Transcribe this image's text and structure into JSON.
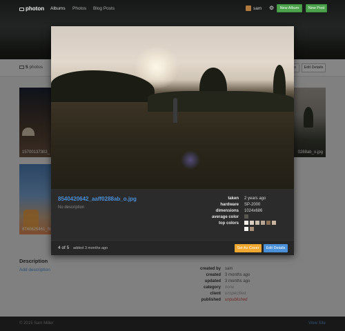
{
  "header": {
    "brand": "photon",
    "nav": [
      "Albums",
      "Photos",
      "Blog Posts"
    ],
    "user": "sam",
    "new_album_label": "New Album",
    "new_post_label": "New Post"
  },
  "toolbar": {
    "photo_count": "5",
    "photos_label": "photos",
    "partial_button_label": "ts",
    "edit_details_label": "Edit Details"
  },
  "grid": {
    "captions": [
      "15700137302_",
      "8740625461_fb",
      "0288ab_o.jpg"
    ]
  },
  "description": {
    "title": "Description",
    "add_link": "Add description"
  },
  "album_meta": [
    {
      "key": "created by",
      "value": "sam",
      "style": "normal"
    },
    {
      "key": "created",
      "value": "3 months ago",
      "style": "normal"
    },
    {
      "key": "updated",
      "value": "3 months ago",
      "style": "normal"
    },
    {
      "key": "category",
      "value": "none",
      "style": "italic"
    },
    {
      "key": "client",
      "value": "unspecified",
      "style": "italic"
    },
    {
      "key": "published",
      "value": "unpublished",
      "style": "red"
    }
  ],
  "footer": {
    "copyright": "© 2015 Sam Miller",
    "view_site": "View Site"
  },
  "modal": {
    "filename": "8540420642_aaff0288ab_o.jpg",
    "description": "No description",
    "details": [
      {
        "key": "taken",
        "value": "2 years ago"
      },
      {
        "key": "hardware",
        "value": "SP-2000"
      },
      {
        "key": "dimensions",
        "value": "1024x686"
      },
      {
        "key": "average color",
        "value": ""
      },
      {
        "key": "top colors",
        "value": ""
      }
    ],
    "average_color": "#5a5650",
    "top_colors": [
      "#f2efe8",
      "#d9cfc4",
      "#cdbfae",
      "#b8a895",
      "#8a6f55",
      "#c9b59e",
      "#f5f3ef",
      "#a89078"
    ],
    "counter": "4 of 5",
    "added": "added 3 months ago",
    "set_cover_label": "Set As Cover",
    "edit_details_label": "Edit Details"
  },
  "colors": {
    "link": "#4a90d9",
    "green": "#4ba34b",
    "orange": "#f0a830",
    "red": "#d04a4a"
  }
}
